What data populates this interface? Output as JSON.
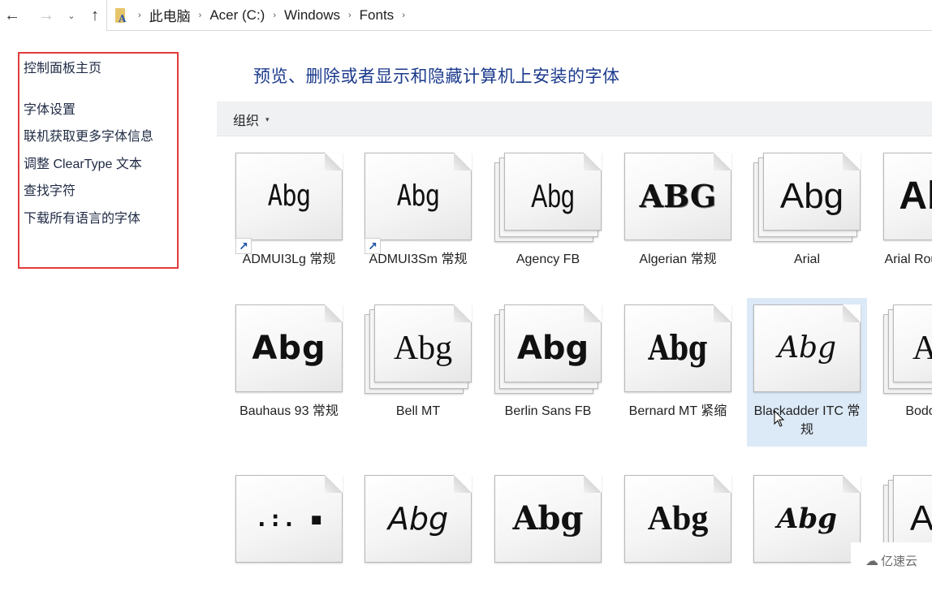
{
  "nav": {
    "back_icon": "arrow-left-icon",
    "forward_icon": "arrow-right-icon",
    "recent_icon": "chevron-down-icon",
    "up_icon": "arrow-up-icon",
    "back_glyph": "←",
    "forward_glyph": "→",
    "recent_glyph": "⌄",
    "up_glyph": "↑"
  },
  "breadcrumb": {
    "items": [
      "此电脑",
      "Acer (C:)",
      "Windows",
      "Fonts"
    ],
    "separator": "›"
  },
  "left_pane": {
    "links": [
      "控制面板主页",
      "字体设置",
      "联机获取更多字体信息",
      "调整 ClearType 文本",
      "查找字符",
      "下载所有语言的字体"
    ],
    "highlight_color": "#e23b3b"
  },
  "main": {
    "title": "预览、删除或者显示和隐藏计算机上安装的字体",
    "toolbar": {
      "organize_label": "组织",
      "organize_caret": "▾"
    }
  },
  "fonts": [
    {
      "name": "ADMUI3Lg 常规",
      "sample": "Abg",
      "style": "s-pixel",
      "stacked": false,
      "shortcut": true,
      "selected": false
    },
    {
      "name": "ADMUI3Sm 常规",
      "sample": "Abg",
      "style": "s-pixel",
      "stacked": false,
      "shortcut": true,
      "selected": false
    },
    {
      "name": "Agency FB",
      "sample": "Abg",
      "style": "s-condensed",
      "stacked": true,
      "shortcut": false,
      "selected": false
    },
    {
      "name": "Algerian 常规",
      "sample": "ABG",
      "style": "s-algerian",
      "stacked": false,
      "shortcut": false,
      "selected": false
    },
    {
      "name": "Arial",
      "sample": "Abg",
      "style": "s-arial",
      "stacked": true,
      "shortcut": false,
      "selected": false
    },
    {
      "name": "Arial Rounded MT",
      "sample": "Abg",
      "style": "s-arialbold",
      "stacked": false,
      "shortcut": false,
      "selected": false
    },
    {
      "name": "Bauhaus 93 常规",
      "sample": "Abg",
      "style": "s-bauhaus",
      "stacked": false,
      "shortcut": false,
      "selected": false
    },
    {
      "name": "Bell MT",
      "sample": "Abg",
      "style": "s-bell",
      "stacked": true,
      "shortcut": false,
      "selected": false
    },
    {
      "name": "Berlin Sans FB",
      "sample": "Abg",
      "style": "s-berlin",
      "stacked": true,
      "shortcut": false,
      "selected": false
    },
    {
      "name": "Bernard MT 紧缩",
      "sample": "Abg",
      "style": "s-bernard",
      "stacked": false,
      "shortcut": false,
      "selected": false
    },
    {
      "name": "Blackadder ITC 常规",
      "sample": "Abg",
      "style": "s-script",
      "stacked": false,
      "shortcut": false,
      "selected": true
    },
    {
      "name": "Bodoni MT",
      "sample": "Abg",
      "style": "s-bodoni",
      "stacked": true,
      "shortcut": false,
      "selected": false
    },
    {
      "name": "",
      "sample": ".:. ▪",
      "style": "s-dots",
      "stacked": false,
      "shortcut": false,
      "selected": false
    },
    {
      "name": "",
      "sample": "Abg",
      "style": "s-hand",
      "stacked": false,
      "shortcut": false,
      "selected": false
    },
    {
      "name": "",
      "sample": "Abg",
      "style": "s-heavyserif",
      "stacked": false,
      "shortcut": false,
      "selected": false
    },
    {
      "name": "",
      "sample": "Abg",
      "style": "s-fatface",
      "stacked": false,
      "shortcut": false,
      "selected": false
    },
    {
      "name": "",
      "sample": "Abg",
      "style": "s-brush",
      "stacked": false,
      "shortcut": false,
      "selected": false
    },
    {
      "name": "",
      "sample": "Abg",
      "style": "s-arial",
      "stacked": true,
      "shortcut": false,
      "selected": false
    }
  ],
  "watermark": {
    "icon": "cloud-logo-icon",
    "text": "亿速云"
  }
}
